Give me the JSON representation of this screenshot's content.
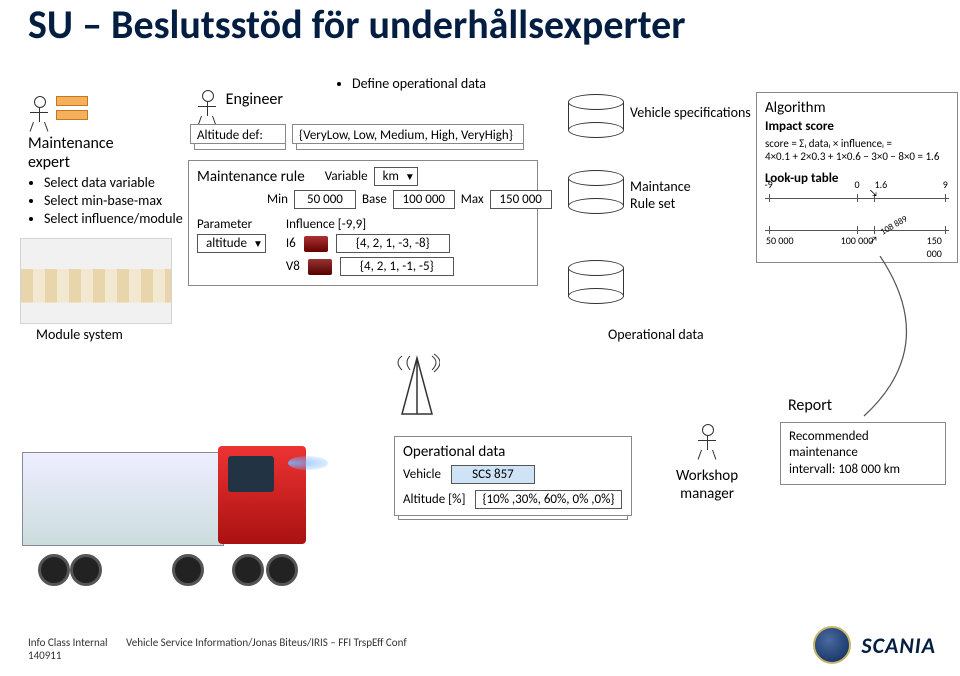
{
  "title": "SU – Beslutsstöd för underhållsexperter",
  "maintenance_expert": {
    "heading": "Maintenance\nexpert",
    "bullets": [
      "Select data variable",
      "Select min-base-max",
      "Select influence/module"
    ]
  },
  "module_system_label": "Module system",
  "engineer": {
    "heading": "Engineer",
    "altitude_def_label": "Altitude def:",
    "altitude_def_value": "{VeryLow, Low, Medium, High, VeryHigh}",
    "define_bullet": "Define operational data"
  },
  "maintenance_rule": {
    "title": "Maintenance rule",
    "variable_label": "Variable",
    "variable_value": "km",
    "min_label": "Min",
    "min_value": "50 000",
    "base_label": "Base",
    "base_value": "100 000",
    "max_label": "Max",
    "max_value": "150 000",
    "parameter_label": "Parameter",
    "parameter_value": "altitude",
    "influence_label": "Influence [-9,9]",
    "rows": [
      {
        "module": "I6",
        "values": "{4, 2, 1, -3, -8}"
      },
      {
        "module": "V8",
        "values": "{4, 2, 1, -1, -5}"
      }
    ]
  },
  "cylinders": {
    "vehicle_specs": "Vehicle specifications",
    "rule_set": "Maintance\nRule set",
    "operational_data": "Operational data"
  },
  "algorithm": {
    "title": "Algorithm",
    "impact_score_label": "Impact score",
    "score_line1": "score = Σᵢ dataᵢ × influenceᵢ =",
    "score_line2": "4×0.1 + 2×0.3 + 1×0.6 − 3×0 − 8×0 = 1.6",
    "lookup_label": "Look-up table",
    "top_scale": {
      "left": "-9",
      "mid": "0",
      "marker": "1.6",
      "right": "9"
    },
    "bottom_scale": {
      "left": "50 000",
      "mid": "100 000",
      "marker": "108 889",
      "right": "150 000"
    }
  },
  "operational_data_panel": {
    "title": "Operational data",
    "vehicle_label": "Vehicle",
    "vehicle_value": "SCS 857",
    "altitude_label": "Altitude [%]",
    "altitude_value": "{10% ,30%, 60%, 0% ,0%}"
  },
  "workshop_manager_label": "Workshop\nmanager",
  "report": {
    "title": "Report",
    "line1": "Recommended",
    "line2": "maintenance",
    "line3": "intervall: 108 000 km"
  },
  "footer": {
    "left1": "Info Class Internal",
    "left2": "140911",
    "center": "Vehicle Service Information/Jonas Biteus/IRIS – FFI TrspEff Conf"
  }
}
